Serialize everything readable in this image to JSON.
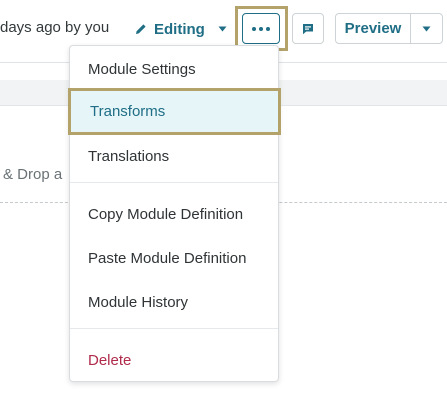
{
  "toolbar": {
    "saved_text": "days ago by you",
    "editing_label": "Editing",
    "preview_label": "Preview"
  },
  "background": {
    "drop_text": "& Drop a"
  },
  "menu": {
    "items": [
      {
        "label": "Module Settings"
      },
      {
        "label": "Transforms"
      },
      {
        "label": "Translations"
      },
      {
        "label": "Copy Module Definition"
      },
      {
        "label": "Paste Module Definition"
      },
      {
        "label": "Module History"
      },
      {
        "label": "Delete"
      }
    ]
  },
  "colors": {
    "accent": "#1f6e86",
    "highlight_border": "#b3a36a",
    "active_item_bg": "#e5f5f8",
    "danger": "#b02a4a"
  },
  "icons": {
    "editing": "pencil-icon",
    "more": "ellipsis-icon",
    "comment": "comment-icon",
    "dropdown": "caret-down-icon"
  }
}
